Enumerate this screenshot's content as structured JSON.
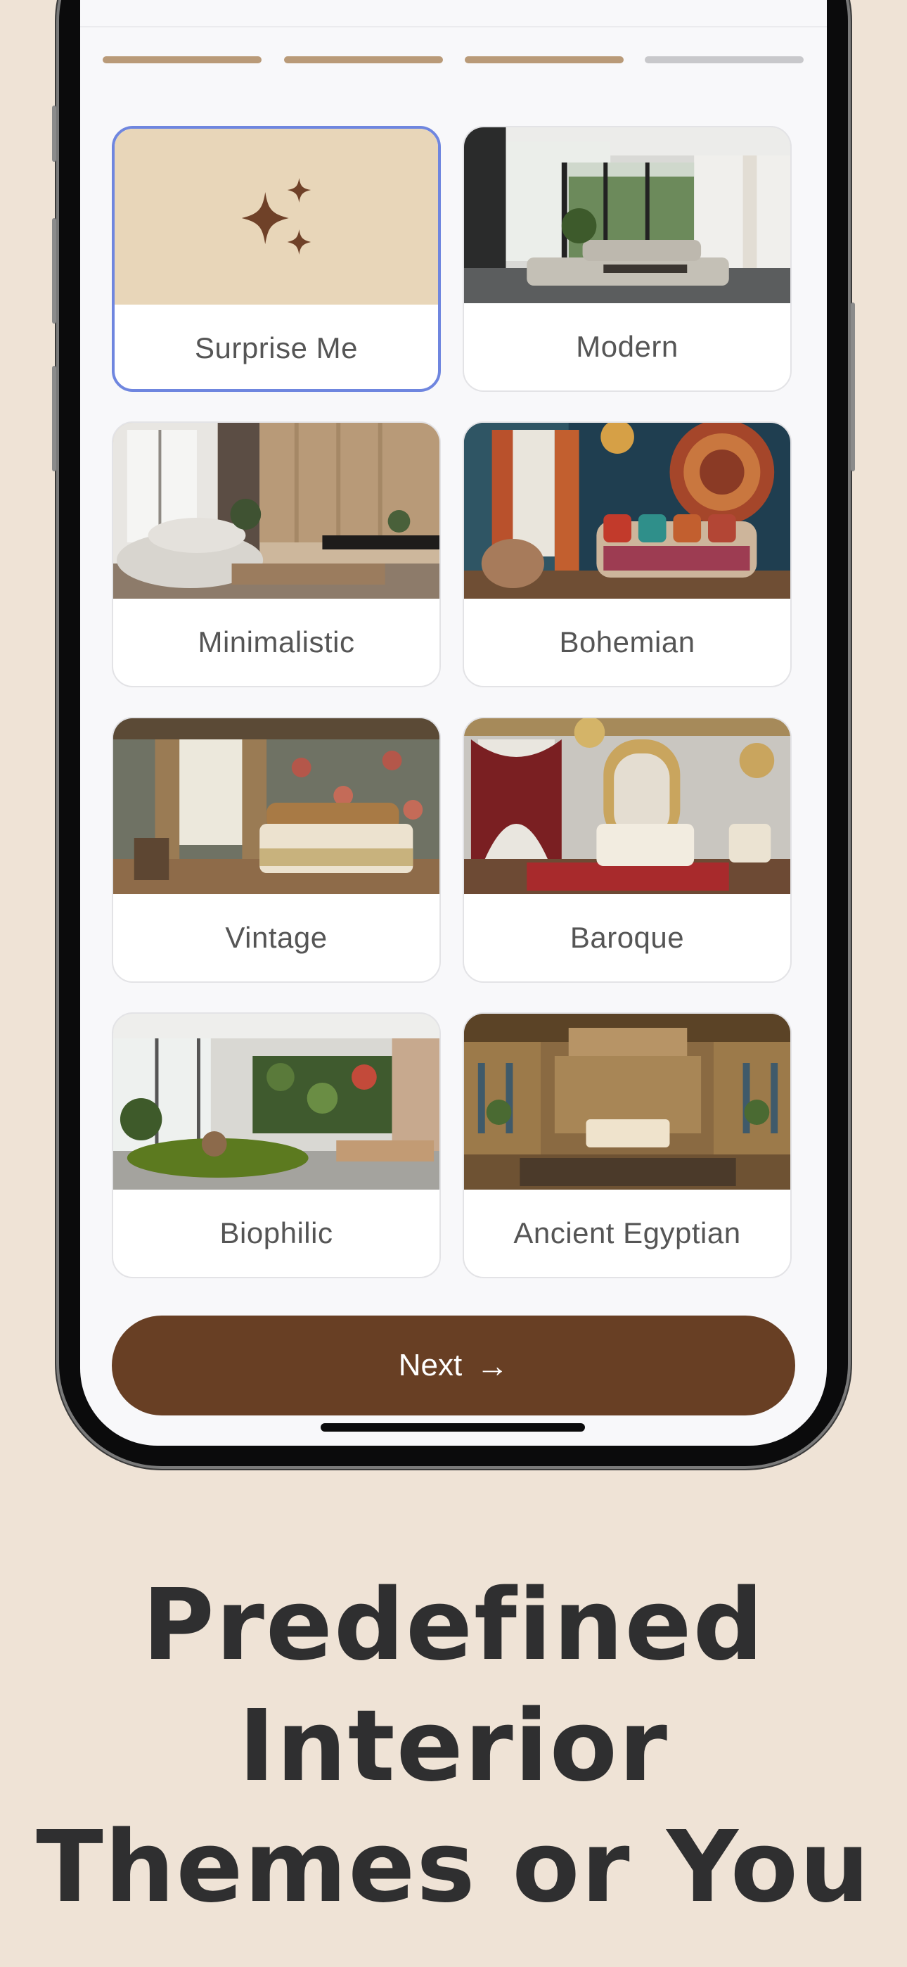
{
  "progress": {
    "total_steps": 4,
    "completed_steps": 3,
    "active_color": "#b99a78",
    "inactive_color": "#c8c8cb"
  },
  "themes": [
    {
      "label": "Surprise Me",
      "icon": "sparkles-icon",
      "selected": true
    },
    {
      "label": "Modern",
      "icon": "modern-room-photo",
      "selected": false
    },
    {
      "label": "Minimalistic",
      "icon": "minimalistic-room-photo",
      "selected": false
    },
    {
      "label": "Bohemian",
      "icon": "bohemian-room-photo",
      "selected": false
    },
    {
      "label": "Vintage",
      "icon": "vintage-room-photo",
      "selected": false
    },
    {
      "label": "Baroque",
      "icon": "baroque-room-photo",
      "selected": false
    },
    {
      "label": "Biophilic",
      "icon": "biophilic-room-photo",
      "selected": false
    },
    {
      "label": "Ancient Egyptian",
      "icon": "ancient-egyptian-room-photo",
      "selected": false
    }
  ],
  "next_button": {
    "label": "Next",
    "icon": "arrow-right-icon",
    "arrow": "→"
  },
  "headline": {
    "line1": "Predefined",
    "line2": "Interior",
    "line3": "Themes or You"
  },
  "colors": {
    "background": "#efe3d6",
    "button": "#683f24",
    "selected_border": "#6f86df",
    "sparkle": "#6f4128",
    "surprise_bg": "#e8d6b9"
  }
}
